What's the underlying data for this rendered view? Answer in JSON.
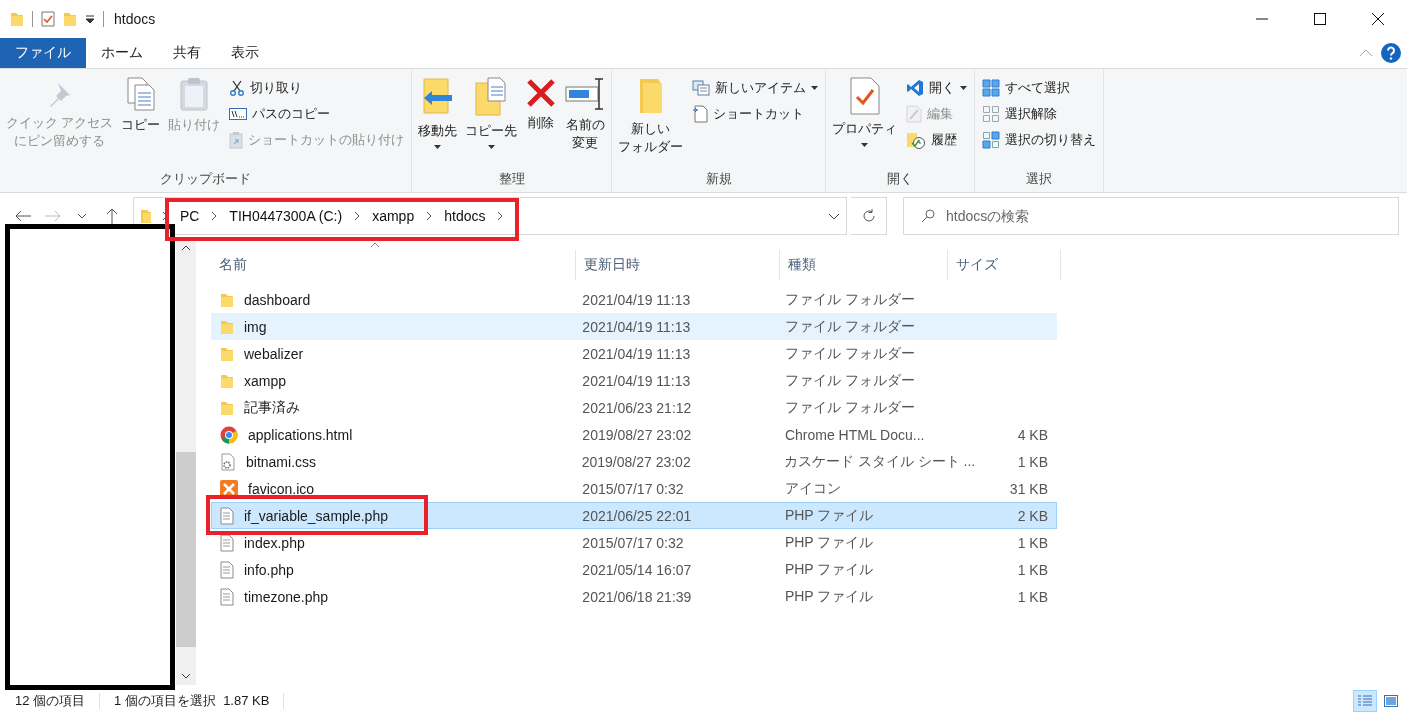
{
  "window": {
    "title": "htdocs"
  },
  "ribbon_tabs": [
    {
      "label": "ファイル",
      "selected": true
    },
    {
      "label": "ホーム",
      "selected": false
    },
    {
      "label": "共有",
      "selected": false
    },
    {
      "label": "表示",
      "selected": false
    }
  ],
  "ribbon": {
    "groups": [
      {
        "label": "クリップボード",
        "items": [
          {
            "kind": "large",
            "lines": [
              "クイック アクセス",
              "にピン留めする"
            ],
            "disabled": true,
            "dropdown": false
          },
          {
            "kind": "large",
            "label": "コピー",
            "disabled": false,
            "dropdown": false
          },
          {
            "kind": "large",
            "label": "貼り付け",
            "disabled": true,
            "dropdown": false
          },
          {
            "kind": "small",
            "label": "切り取り",
            "disabled": false,
            "dropdown": false
          },
          {
            "kind": "small",
            "label": "パスのコピー",
            "disabled": false,
            "dropdown": false
          },
          {
            "kind": "small",
            "label": "ショートカットの貼り付け",
            "disabled": true,
            "dropdown": false
          }
        ]
      },
      {
        "label": "整理",
        "items": [
          {
            "kind": "large",
            "label": "移動先",
            "disabled": false,
            "dropdown": true
          },
          {
            "kind": "large",
            "label": "コピー先",
            "disabled": false,
            "dropdown": true
          },
          {
            "kind": "large",
            "label": "削除",
            "disabled": false,
            "dropdown": false
          },
          {
            "kind": "large",
            "lines": [
              "名前の",
              "変更"
            ],
            "disabled": false,
            "dropdown": false
          }
        ]
      },
      {
        "label": "新規",
        "items": [
          {
            "kind": "large",
            "lines": [
              "新しい",
              "フォルダー"
            ],
            "disabled": false,
            "dropdown": false
          },
          {
            "kind": "small",
            "label": "新しいアイテム",
            "disabled": false,
            "dropdown": true
          },
          {
            "kind": "small",
            "label": "ショートカット",
            "disabled": false,
            "dropdown": false
          }
        ]
      },
      {
        "label": "開く",
        "items": [
          {
            "kind": "large",
            "label": "プロパティ",
            "disabled": false,
            "dropdown": true
          },
          {
            "kind": "small",
            "label": "開く",
            "disabled": false,
            "dropdown": true
          },
          {
            "kind": "small",
            "label": "編集",
            "disabled": true,
            "dropdown": false
          },
          {
            "kind": "small",
            "label": "履歴",
            "disabled": false,
            "dropdown": false
          }
        ]
      },
      {
        "label": "選択",
        "items": [
          {
            "kind": "small",
            "label": "すべて選択",
            "disabled": false,
            "dropdown": false
          },
          {
            "kind": "small",
            "label": "選択解除",
            "disabled": false,
            "dropdown": false
          },
          {
            "kind": "small",
            "label": "選択の切り替え",
            "disabled": false,
            "dropdown": false
          }
        ]
      }
    ]
  },
  "address": {
    "crumbs": [
      "PC",
      "TIH0447300A (C:)",
      "xampp",
      "htdocs"
    ]
  },
  "search": {
    "placeholder": "htdocsの検索"
  },
  "columns": [
    "名前",
    "更新日時",
    "種類",
    "サイズ"
  ],
  "files": [
    {
      "kind": "folder",
      "name": "dashboard",
      "date": "2021/04/19 11:13",
      "type": "ファイル フォルダー",
      "selected": false,
      "hovered": false
    },
    {
      "kind": "folder",
      "name": "img",
      "date": "2021/04/19 11:13",
      "type": "ファイル フォルダー",
      "selected": false,
      "hovered": true
    },
    {
      "kind": "folder",
      "name": "webalizer",
      "date": "2021/04/19 11:13",
      "type": "ファイル フォルダー",
      "selected": false,
      "hovered": false
    },
    {
      "kind": "folder",
      "name": "xampp",
      "date": "2021/04/19 11:13",
      "type": "ファイル フォルダー",
      "selected": false,
      "hovered": false
    },
    {
      "kind": "folder",
      "name": "記事済み",
      "date": "2021/06/23 21:12",
      "type": "ファイル フォルダー",
      "selected": false,
      "hovered": false
    },
    {
      "kind": "chrome",
      "name": "applications.html",
      "date": "2019/08/27 23:02",
      "type": "Chrome HTML Docu...",
      "size": "4 KB",
      "selected": false,
      "hovered": false
    },
    {
      "kind": "css",
      "name": "bitnami.css",
      "date": "2019/08/27 23:02",
      "type": "カスケード スタイル シート ...",
      "size": "1 KB",
      "selected": false,
      "hovered": false
    },
    {
      "kind": "xampp",
      "name": "favicon.ico",
      "date": "2015/07/17 0:32",
      "type": "アイコン",
      "size": "31 KB",
      "selected": false,
      "hovered": false
    },
    {
      "kind": "php",
      "name": "if_variable_sample.php",
      "date": "2021/06/25 22:01",
      "type": "PHP ファイル",
      "size": "2 KB",
      "selected": true,
      "hovered": false
    },
    {
      "kind": "php",
      "name": "index.php",
      "date": "2015/07/17 0:32",
      "type": "PHP ファイル",
      "size": "1 KB",
      "selected": false,
      "hovered": false
    },
    {
      "kind": "php",
      "name": "info.php",
      "date": "2021/05/14 16:07",
      "type": "PHP ファイル",
      "size": "1 KB",
      "selected": false,
      "hovered": false
    },
    {
      "kind": "php",
      "name": "timezone.php",
      "date": "2021/06/18 21:39",
      "type": "PHP ファイル",
      "size": "1 KB",
      "selected": false,
      "hovered": false
    }
  ],
  "status_bar": {
    "item_count": "12 個の項目",
    "selection": "1 個の項目を選択  1.87 KB"
  },
  "view_buttons": [
    {
      "selected": true
    },
    {
      "selected": false
    }
  ]
}
